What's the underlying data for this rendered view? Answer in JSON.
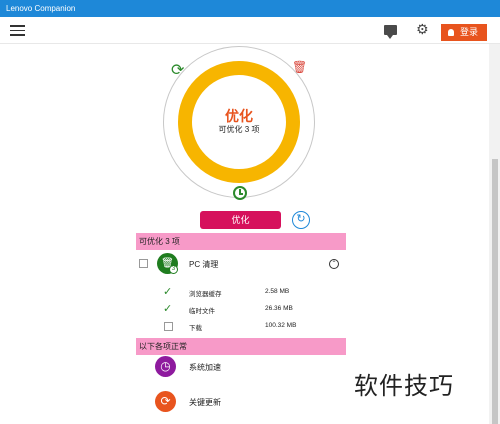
{
  "window": {
    "title": "Lenovo Companion"
  },
  "toolbar": {
    "login_label": "登录"
  },
  "ring": {
    "title": "优化",
    "subtitle": "可优化 3 项"
  },
  "actions": {
    "optimize_label": "优化"
  },
  "section_optimizable": {
    "header": "可优化 3 项",
    "group": {
      "label": "PC 清理",
      "badge": "3",
      "items": [
        {
          "label": "浏览器缓存",
          "size": "2.58 MB",
          "checked": true
        },
        {
          "label": "临时文件",
          "size": "26.36 MB",
          "checked": true
        },
        {
          "label": "下载",
          "size": "100.32 MB",
          "checked": false
        }
      ]
    }
  },
  "section_normal": {
    "header": "以下各项正常",
    "items": [
      {
        "label": "系统加速",
        "icon": "clock-icon",
        "color": "#8e1a9e"
      },
      {
        "label": "关键更新",
        "icon": "refresh-icon",
        "color": "#e8541e"
      }
    ]
  },
  "watermark": "软件技巧",
  "colors": {
    "titlebar": "#1e88d8",
    "ring": "#f7b500",
    "accent": "#e8541e",
    "optimize_button": "#d6115c",
    "section_header": "#f79ac8",
    "green": "#2c8a2c"
  }
}
